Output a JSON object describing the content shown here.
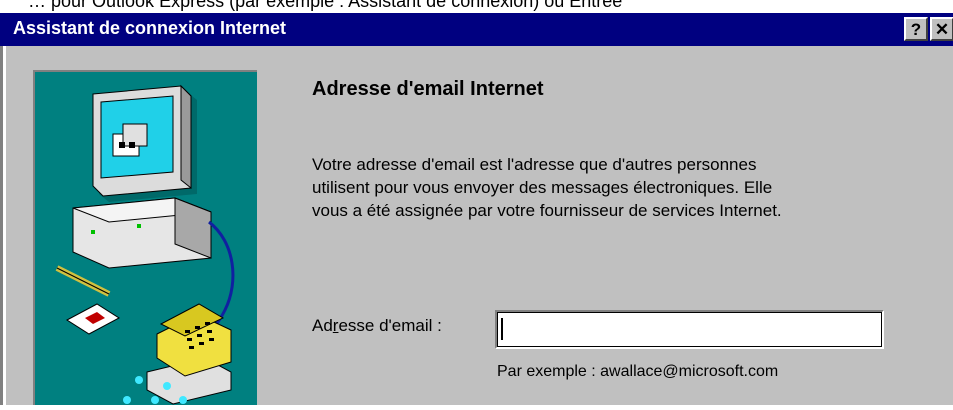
{
  "top_strip": {
    "text": "… pour Outlook Express (par exemple : Assistant de connexion) ou Entrée"
  },
  "window": {
    "title": "Assistant de connexion Internet",
    "help_label": "?",
    "close_label": "✕"
  },
  "illustration": {
    "icon": "computer-telephone-illustration"
  },
  "page": {
    "title": "Adresse d'email Internet",
    "description_lines": [
      "Votre adresse d'email est l'adresse que d'autres personnes",
      "utilisent pour vous envoyer des messages électroniques. Elle",
      "vous a été assignée par votre fournisseur de services Internet."
    ],
    "email_label_pre": "Ad",
    "email_label_mnemonic": "r",
    "email_label_post": "esse d'email :",
    "email_value": "",
    "example": "Par exemple : awallace@microsoft.com"
  },
  "colors": {
    "titlebar": "#000080",
    "window_face": "#c0c0c0",
    "illustration_bg": "#008080"
  }
}
